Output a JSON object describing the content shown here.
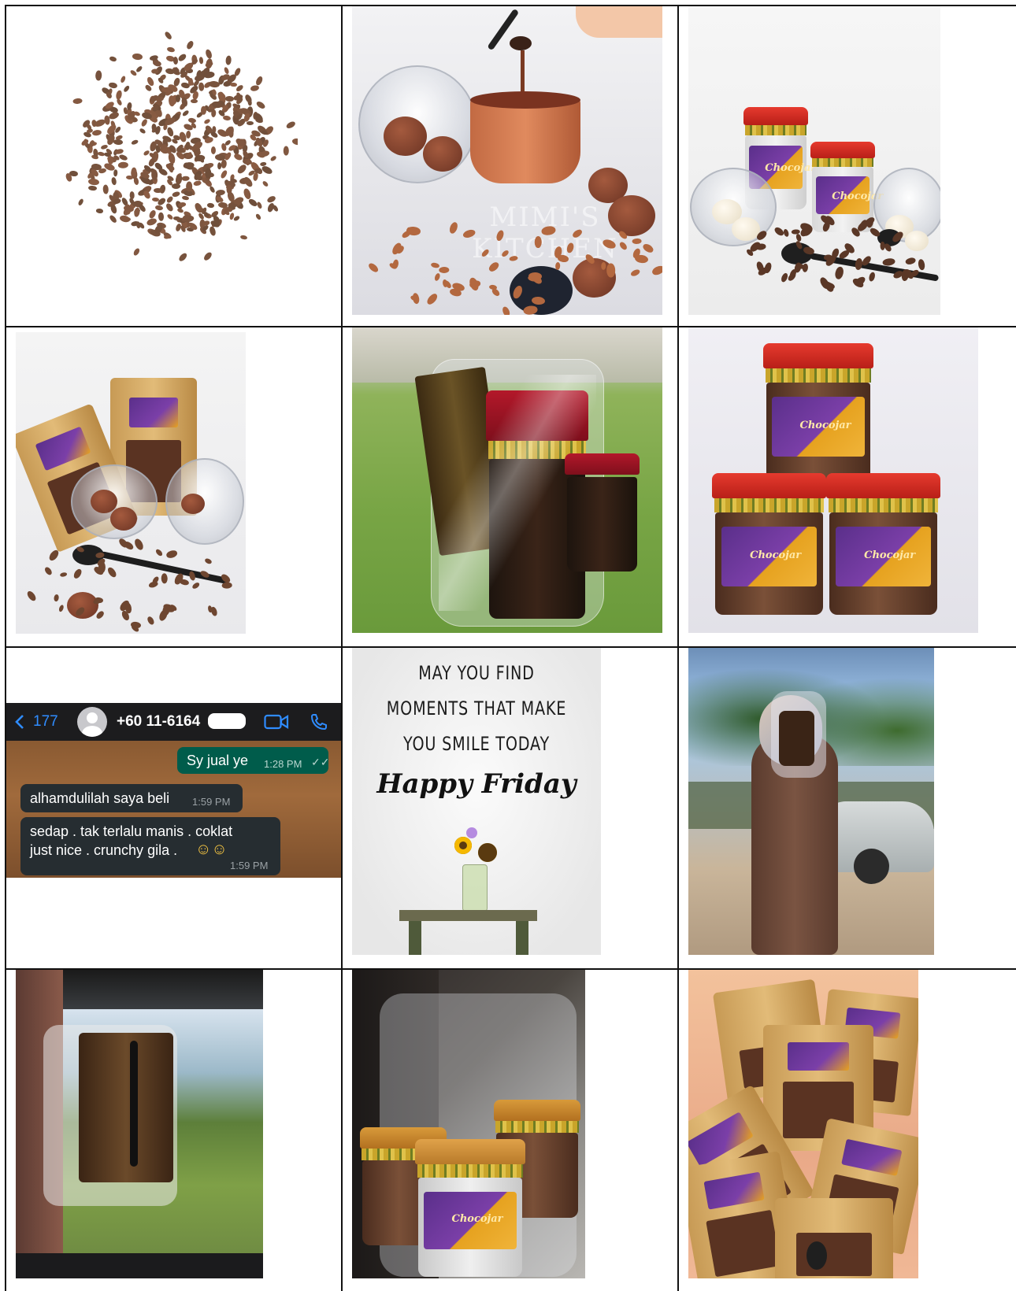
{
  "chat": {
    "back_count": "177",
    "contact_number": "+60 11-6164",
    "sent_message": "Sy jual ye",
    "sent_time": "1:28 PM",
    "received_1": "alhamdulilah saya beli",
    "received_1_time": "1:59 PM",
    "received_2_line1": "sedap . tak terlalu manis . coklat",
    "received_2_line2": "just nice . crunchy gila .",
    "received_2_emoji": "☺☺",
    "received_2_time": "1:59 PM"
  },
  "quote": {
    "line1": "MAY YOU FIND",
    "line2": "MOMENTS THAT MAKE",
    "line3": "YOU SMILE TODAY",
    "script": "Happy Friday"
  },
  "watermark": "MIMI'S KITCHEN",
  "product_label": "Chocojar",
  "icons": [
    "back-chevron-icon",
    "avatar-icon",
    "video-call-icon",
    "phone-icon",
    "double-check-icon"
  ]
}
